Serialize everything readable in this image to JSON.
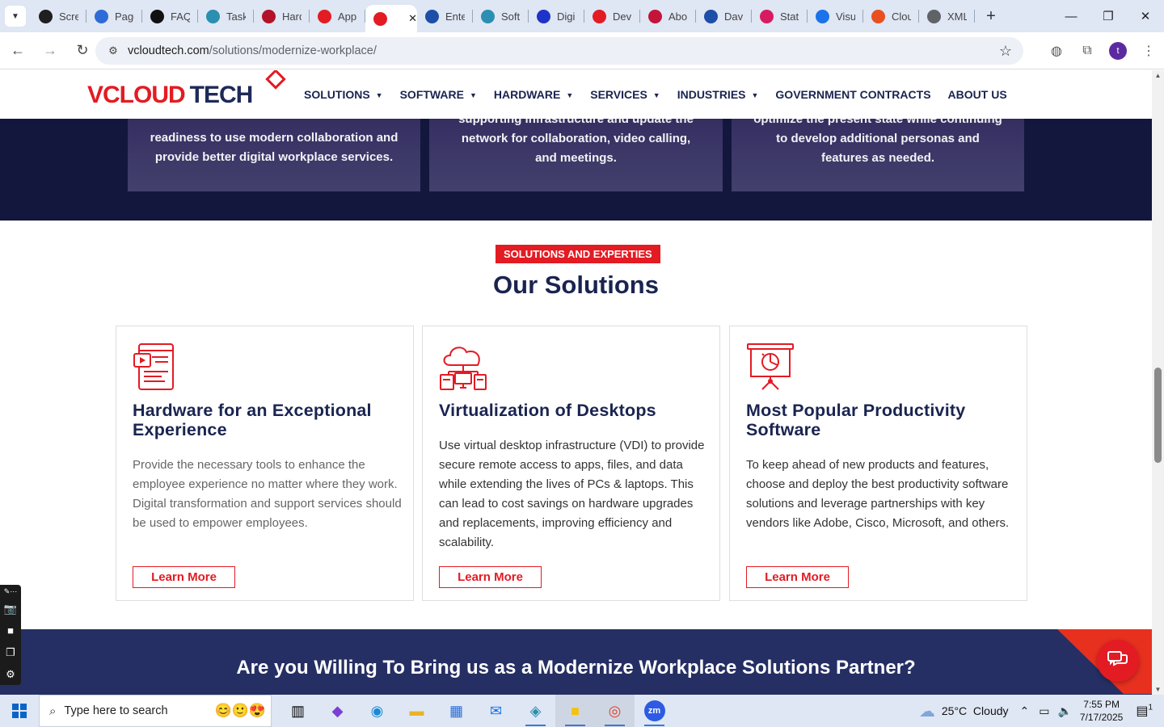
{
  "browser": {
    "tabs": [
      {
        "title": "Scre",
        "icon": "screen-icon",
        "color": "#1f1f1f"
      },
      {
        "title": "Page",
        "icon": "page-icon",
        "color": "#2e6bd6"
      },
      {
        "title": "FAQ",
        "icon": "faq-icon",
        "color": "#111111"
      },
      {
        "title": "Task",
        "icon": "task-icon",
        "color": "#2a8fb0"
      },
      {
        "title": "Hard",
        "icon": "hardware-icon",
        "color": "#b3122a"
      },
      {
        "title": "App",
        "icon": "app-icon",
        "color": "#e31b23"
      },
      {
        "title": "",
        "icon": "vcloud-icon",
        "color": "#e31b23",
        "active": true
      },
      {
        "title": "Ente",
        "icon": "enterprise-icon",
        "color": "#1d4fa8"
      },
      {
        "title": "Soft",
        "icon": "software-icon",
        "color": "#2a8fb0"
      },
      {
        "title": "Digi",
        "icon": "digital-icon",
        "color": "#2033c8"
      },
      {
        "title": "Dev",
        "icon": "dev-icon",
        "color": "#e31b23"
      },
      {
        "title": "Abo",
        "icon": "about-icon",
        "color": "#c4143a"
      },
      {
        "title": "Dav",
        "icon": "dav-icon",
        "color": "#1d4fa8"
      },
      {
        "title": "Stat",
        "icon": "stat-icon",
        "color": "#d81b60"
      },
      {
        "title": "Visu",
        "icon": "visual-icon",
        "color": "#1a73e8"
      },
      {
        "title": "Clou",
        "icon": "cloud-icon",
        "color": "#e8501f"
      },
      {
        "title": "XML",
        "icon": "globe-icon",
        "color": "#5f6368"
      }
    ],
    "url_domain": "vcloudtech.com",
    "url_path": "/solutions/modernize-workplace/"
  },
  "site": {
    "logo_part1": "VCLOUD",
    "logo_part2": "TECH",
    "menu": [
      {
        "label": "SOLUTIONS",
        "dropdown": true
      },
      {
        "label": "SOFTWARE",
        "dropdown": true
      },
      {
        "label": "HARDWARE",
        "dropdown": true
      },
      {
        "label": "SERVICES",
        "dropdown": true
      },
      {
        "label": "INDUSTRIES",
        "dropdown": true
      },
      {
        "label": "GOVERNMENT CONTRACTS",
        "dropdown": false
      },
      {
        "label": "ABOUT US",
        "dropdown": false
      }
    ]
  },
  "dark_cards": [
    {
      "text": "readiness to use modern collaboration and provide better digital workplace services."
    },
    {
      "text": "supporting infrastructure and update the network for collaboration, video calling, and meetings."
    },
    {
      "text": "optimize the present state while continuing to develop additional personas and features as needed."
    }
  ],
  "solutions": {
    "eyebrow": "SOLUTIONS AND EXPERTIES",
    "title": "Our Solutions",
    "cards": [
      {
        "icon": "tablet-video-icon",
        "title": "Hardware for an Exceptional Experience",
        "body": "Provide the necessary tools to enhance the employee experience no matter where they work. Digital transformation and support services should be used to empower employees.",
        "button": "Learn More"
      },
      {
        "icon": "cloud-network-icon",
        "title": "Virtualization of Desktops",
        "body": "Use virtual desktop infrastructure (VDI) to provide secure remote access to apps, files, and data while extending the lives of PCs & laptops. This can lead to cost savings on hardware upgrades and replacements, improving efficiency and scalability.",
        "button": "Learn More"
      },
      {
        "icon": "presentation-chart-icon",
        "title": "Most Popular Productivity Software",
        "body": "To keep ahead of new products and features, choose and deploy the best productivity software solutions and leverage partnerships with key vendors like Adobe, Cisco, Microsoft, and others.",
        "button": "Learn More"
      }
    ]
  },
  "cta": {
    "text": "Are you Willing To Bring us as a Modernize Workplace Solutions Partner?"
  },
  "taskbar": {
    "search_placeholder": "Type here to search",
    "weather": "25°C  Cloudy",
    "time": "7:55 PM",
    "date": "7/17/2025",
    "notification_count": "1"
  },
  "colors": {
    "brand_red": "#e31b23",
    "navy": "#1a2450",
    "dark_band": "#13173e",
    "cta_band": "#262f63"
  }
}
